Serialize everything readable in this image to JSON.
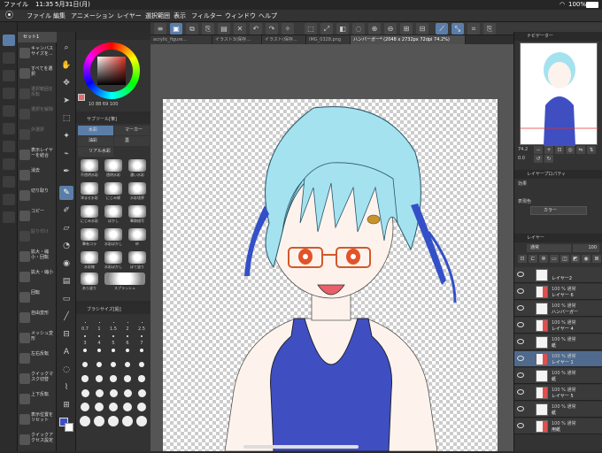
{
  "status_bar": {
    "device": "ファイル",
    "time": "11:35",
    "date": "5月31日(月)",
    "battery": "100%"
  },
  "menu": {
    "items": [
      "ファイル",
      "編集",
      "アニメーション",
      "レイヤー",
      "選択範囲",
      "表示",
      "フィルター",
      "ウィンドウ",
      "ヘルプ"
    ]
  },
  "tabs": [
    {
      "label": "acrylic_figure..."
    },
    {
      "label": "イラスト3(保存..."
    },
    {
      "label": "イラスト(保存..."
    },
    {
      "label": "IMG_0328.png"
    },
    {
      "label": "ハンバーガー* (2048 x 2732px 72dpi 74.2%)"
    }
  ],
  "auto_actions": {
    "header": "セット1",
    "items": [
      {
        "label": "キャンバスサイズを..."
      },
      {
        "label": "すべてを選択"
      },
      {
        "label": "選択範囲を反転"
      },
      {
        "label": "選択を解除"
      },
      {
        "label": "外選択"
      },
      {
        "label": "表示レイヤーを結合"
      },
      {
        "label": "消去"
      },
      {
        "label": "切り取り"
      },
      {
        "label": "コピー"
      },
      {
        "label": "貼り付け"
      },
      {
        "label": "拡大・縮小・回転"
      },
      {
        "label": "拡大・縮小"
      },
      {
        "label": "回転"
      },
      {
        "label": "自由変形"
      },
      {
        "label": "メッシュ変形"
      },
      {
        "label": "左右反転"
      },
      {
        "label": "クイックマスク切替"
      },
      {
        "label": "上下反転"
      },
      {
        "label": "表示位置をリセット"
      },
      {
        "label": "クイックアクセス設定"
      }
    ]
  },
  "color": {
    "readout": "10  88  69  100"
  },
  "sub_tool": {
    "header": "サブツール[筆]",
    "tabs": [
      {
        "label": "水彩"
      },
      {
        "label": "マーカー"
      },
      {
        "label": "油彩"
      },
      {
        "label": "墨"
      },
      {
        "label": "リアル水彩"
      }
    ],
    "brushes": [
      {
        "label": "不透明水彩"
      },
      {
        "label": "透明水彩"
      },
      {
        "label": "濃い水彩"
      },
      {
        "label": "滲ませ水彩"
      },
      {
        "label": "にじみ縁"
      },
      {
        "label": "水彩境界"
      },
      {
        "label": "にじみ水彩"
      },
      {
        "label": "ぼかし"
      },
      {
        "label": "筆跡描写"
      },
      {
        "label": "筆有コラ"
      },
      {
        "label": "水彩ぼかし"
      },
      {
        "label": "紗"
      },
      {
        "label": "水彩3"
      },
      {
        "label": "水彩ぼかし"
      },
      {
        "label": "水彩線"
      },
      {
        "label": "水彩ぼかし"
      },
      {
        "label": "水彩ぼかし"
      },
      {
        "label": "ぼて塗り"
      },
      {
        "label": "あら塗り"
      },
      {
        "label": "スプラッシュ"
      }
    ]
  },
  "brush_size": {
    "header": "ブラシサイズ[鉛]",
    "values": [
      "0.7",
      "1",
      "1.5",
      "2",
      "2.5",
      "3",
      "4",
      "5",
      "6",
      "7",
      "8",
      "10",
      "12",
      "15",
      "17",
      "20",
      "25",
      "30",
      "40",
      "50",
      "60",
      "70",
      "80",
      "100",
      "120",
      "150",
      "170",
      "200",
      "250",
      "300",
      "350",
      "400",
      "500",
      "600",
      "700",
      "800",
      "1000",
      "1200",
      "1500",
      "1700"
    ]
  },
  "navigator": {
    "header": "ナビゲーター",
    "zoom": "74.2",
    "angle": "0.0"
  },
  "layer_property": {
    "header": "レイヤープロパティ",
    "effect_label": "効果",
    "color_label": "表現色",
    "color_value": "カラー"
  },
  "layers": {
    "header": "レイヤー",
    "blend": "通常",
    "opacity": "100",
    "items": [
      {
        "pct": "",
        "name": "レイヤー2"
      },
      {
        "pct": "100 %  通常",
        "name": "レイヤー 6"
      },
      {
        "pct": "100 %  通常",
        "name": "ハンバーガー"
      },
      {
        "pct": "100 %  通常",
        "name": "レイヤー 4"
      },
      {
        "pct": "100 %  通常",
        "name": "紙"
      },
      {
        "pct": "100 %  通常",
        "name": "レイヤー 1"
      },
      {
        "pct": "100 %  通常",
        "name": "紙"
      },
      {
        "pct": "100 %  通常",
        "name": "レイヤー 5"
      },
      {
        "pct": "100 %  通常",
        "name": "紙"
      },
      {
        "pct": "100 %  通常",
        "name": "用紙"
      }
    ]
  },
  "colors": {
    "accent": "#5b7ea8",
    "hair": "#a4e2f0",
    "swimsuit": "#3f4fc2",
    "skin": "#fdf3ec",
    "ribbon": "#3350c8"
  }
}
